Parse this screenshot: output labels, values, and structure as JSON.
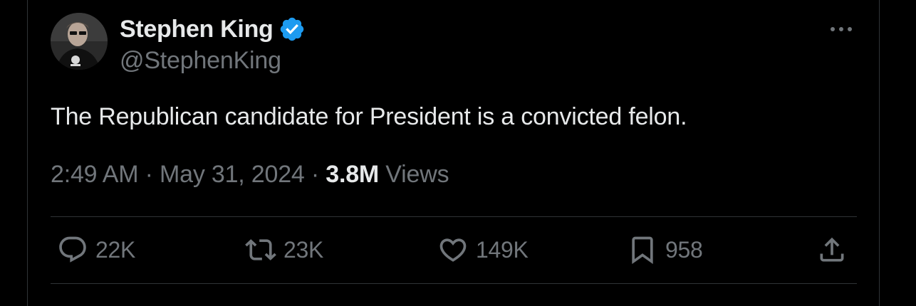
{
  "author": {
    "display_name": "Stephen King",
    "handle": "@StephenKing",
    "verified": true,
    "verified_color": "#1d9bf0"
  },
  "more_icon": "more-horizontal-icon",
  "tweet": {
    "text": "The Republican candidate for President is a convicted felon.",
    "time": "2:49 AM",
    "separator": "·",
    "date": "May 31, 2024",
    "views_count": "3.8M",
    "views_label": "Views"
  },
  "actions": {
    "reply": {
      "icon": "reply-icon",
      "count": "22K"
    },
    "repost": {
      "icon": "repost-icon",
      "count": "23K"
    },
    "like": {
      "icon": "like-icon",
      "count": "149K"
    },
    "bookmark": {
      "icon": "bookmark-icon",
      "count": "958"
    },
    "share": {
      "icon": "share-icon"
    }
  },
  "colors": {
    "background": "#000000",
    "primary_text": "#e7e9ea",
    "secondary_text": "#71767b",
    "border": "#2f3336"
  }
}
